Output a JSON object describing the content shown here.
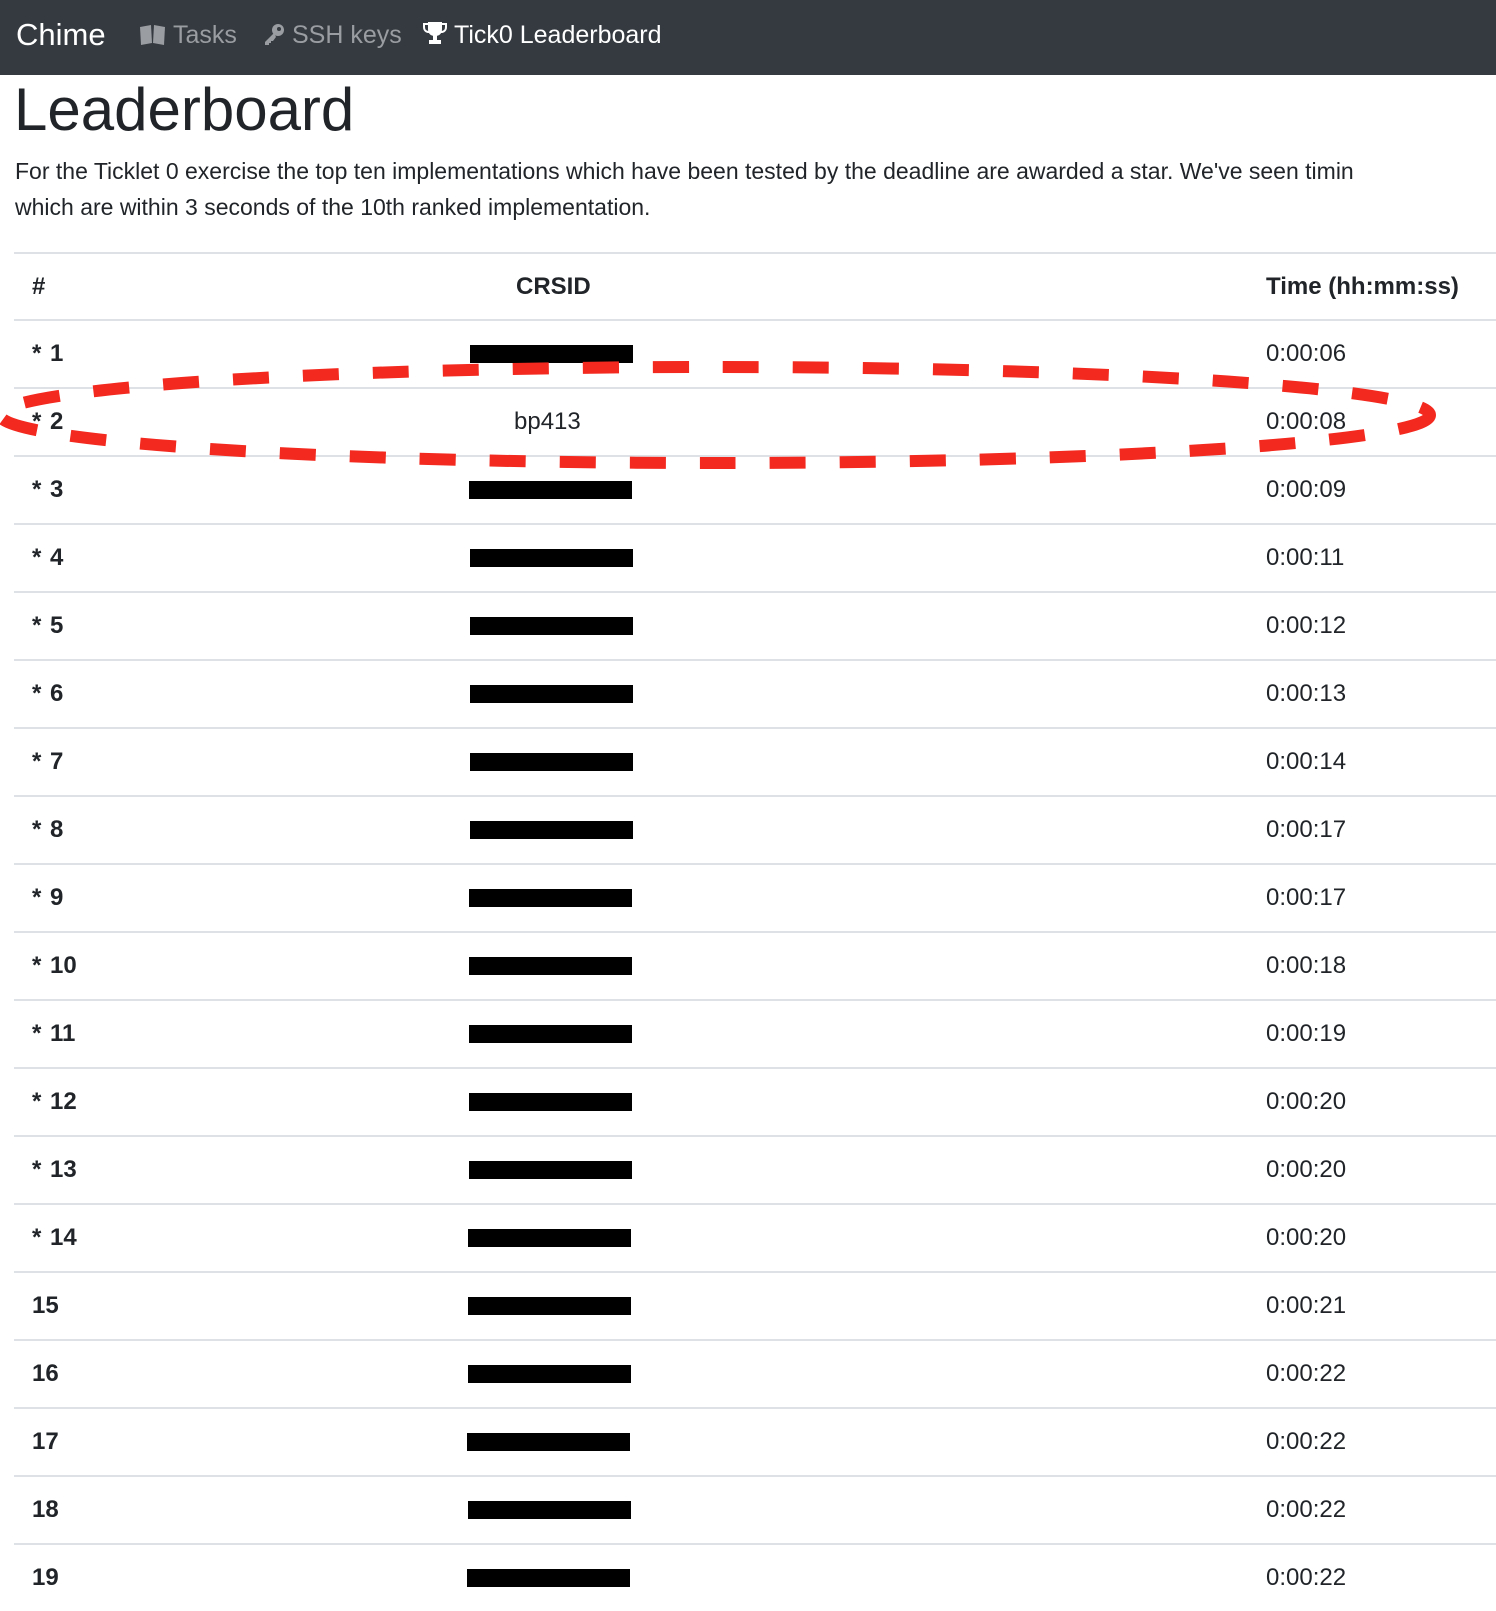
{
  "navbar": {
    "brand": "Chime",
    "items": [
      {
        "label": "Tasks",
        "icon": "book-icon",
        "active": false
      },
      {
        "label": "SSH keys",
        "icon": "key-icon",
        "active": false
      },
      {
        "label": "Tick0 Leaderboard",
        "icon": "trophy-icon",
        "active": true
      }
    ]
  },
  "page": {
    "title": "Leaderboard",
    "intro_line1": "For the Ticklet 0 exercise the top ten implementations which have been tested by the deadline are awarded a star. We've seen timin",
    "intro_line2": "which are within 3 seconds of the 10th ranked implementation."
  },
  "table": {
    "headers": {
      "rank": "#",
      "crsid": "CRSID",
      "time": "Time (hh:mm:ss)"
    },
    "rows": [
      {
        "star": "*",
        "rank": "1",
        "crsid": "",
        "redacted": true,
        "time": "0:00:06"
      },
      {
        "star": "*",
        "rank": "2",
        "crsid": "bp413",
        "redacted": false,
        "time": "0:00:08"
      },
      {
        "star": "*",
        "rank": "3",
        "crsid": "",
        "redacted": true,
        "time": "0:00:09"
      },
      {
        "star": "*",
        "rank": "4",
        "crsid": "",
        "redacted": true,
        "time": "0:00:11"
      },
      {
        "star": "*",
        "rank": "5",
        "crsid": "",
        "redacted": true,
        "time": "0:00:12"
      },
      {
        "star": "*",
        "rank": "6",
        "crsid": "",
        "redacted": true,
        "time": "0:00:13"
      },
      {
        "star": "*",
        "rank": "7",
        "crsid": "",
        "redacted": true,
        "time": "0:00:14"
      },
      {
        "star": "*",
        "rank": "8",
        "crsid": "",
        "redacted": true,
        "time": "0:00:17"
      },
      {
        "star": "*",
        "rank": "9",
        "crsid": "",
        "redacted": true,
        "time": "0:00:17"
      },
      {
        "star": "*",
        "rank": "10",
        "crsid": "",
        "redacted": true,
        "time": "0:00:18"
      },
      {
        "star": "*",
        "rank": "11",
        "crsid": "",
        "redacted": true,
        "time": "0:00:19"
      },
      {
        "star": "*",
        "rank": "12",
        "crsid": "",
        "redacted": true,
        "time": "0:00:20"
      },
      {
        "star": "*",
        "rank": "13",
        "crsid": "",
        "redacted": true,
        "time": "0:00:20"
      },
      {
        "star": "*",
        "rank": "14",
        "crsid": "",
        "redacted": true,
        "time": "0:00:20"
      },
      {
        "star": "",
        "rank": "15",
        "crsid": "",
        "redacted": true,
        "time": "0:00:21"
      },
      {
        "star": "",
        "rank": "16",
        "crsid": "",
        "redacted": true,
        "time": "0:00:22"
      },
      {
        "star": "",
        "rank": "17",
        "crsid": "",
        "redacted": true,
        "time": "0:00:22"
      },
      {
        "star": "",
        "rank": "18",
        "crsid": "",
        "redacted": true,
        "time": "0:00:22"
      },
      {
        "star": "",
        "rank": "19",
        "crsid": "",
        "redacted": true,
        "time": "0:00:22"
      }
    ]
  },
  "colors": {
    "navbar_bg": "#343a40",
    "annotation": "#f3281e"
  }
}
